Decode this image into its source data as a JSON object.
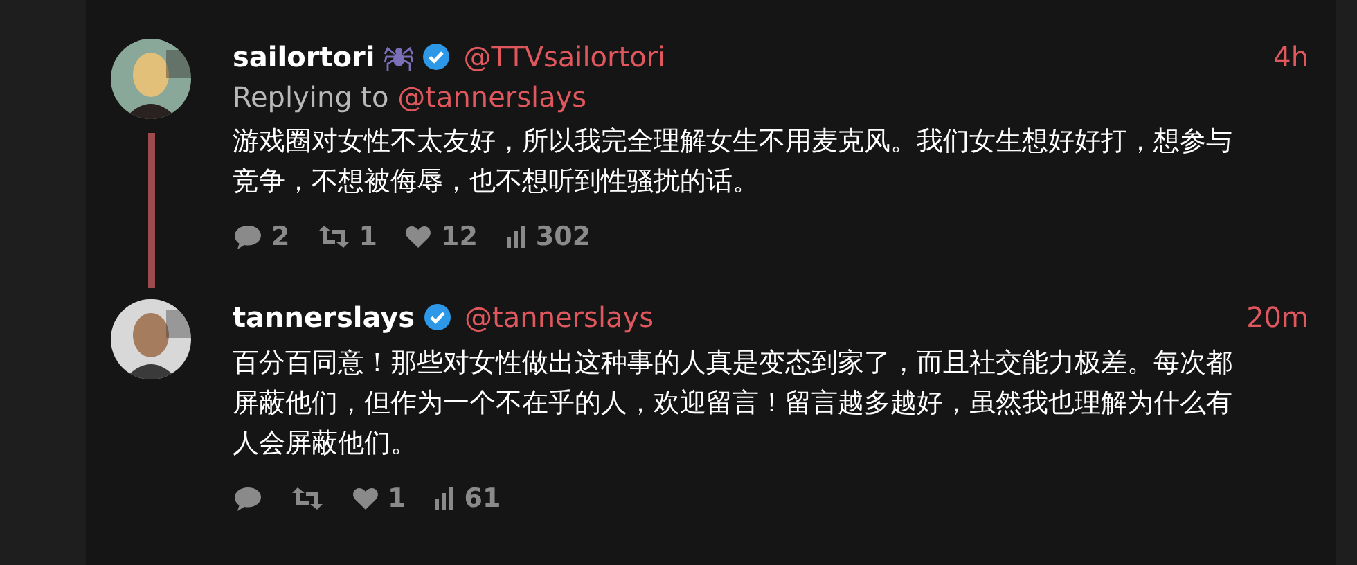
{
  "tweets": [
    {
      "display_name": "sailortori",
      "name_icon": true,
      "verified": true,
      "handle": "@TTVsailortori",
      "time": "4h",
      "replying_to": {
        "label": "Replying to",
        "handle": "@tannerslays"
      },
      "text": "游戏圈对女性不太友好，所以我完全理解女生不用麦克风。我们女生想好好打，想参与竞争，不想被侮辱，也不想听到性骚扰的话。",
      "thread_line": true,
      "stats": [
        {
          "kind": "reply",
          "count": "2"
        },
        {
          "kind": "retweet",
          "count": "1"
        },
        {
          "kind": "like",
          "count": "12"
        },
        {
          "kind": "views",
          "count": "302"
        }
      ]
    },
    {
      "display_name": "tannerslays",
      "verified": true,
      "handle": "@tannerslays",
      "time": "20m",
      "text": "百分百同意！那些对女性做出这种事的人真是变态到家了，而且社交能力极差。每次都屏蔽他们，但作为一个不在乎的人，欢迎留言！留言越多越好，虽然我也理解为什么有人会屏蔽他们。",
      "thread_line": false,
      "stats": [
        {
          "kind": "reply"
        },
        {
          "kind": "retweet"
        },
        {
          "kind": "like",
          "count": "1"
        },
        {
          "kind": "views",
          "count": "61"
        }
      ]
    }
  ]
}
